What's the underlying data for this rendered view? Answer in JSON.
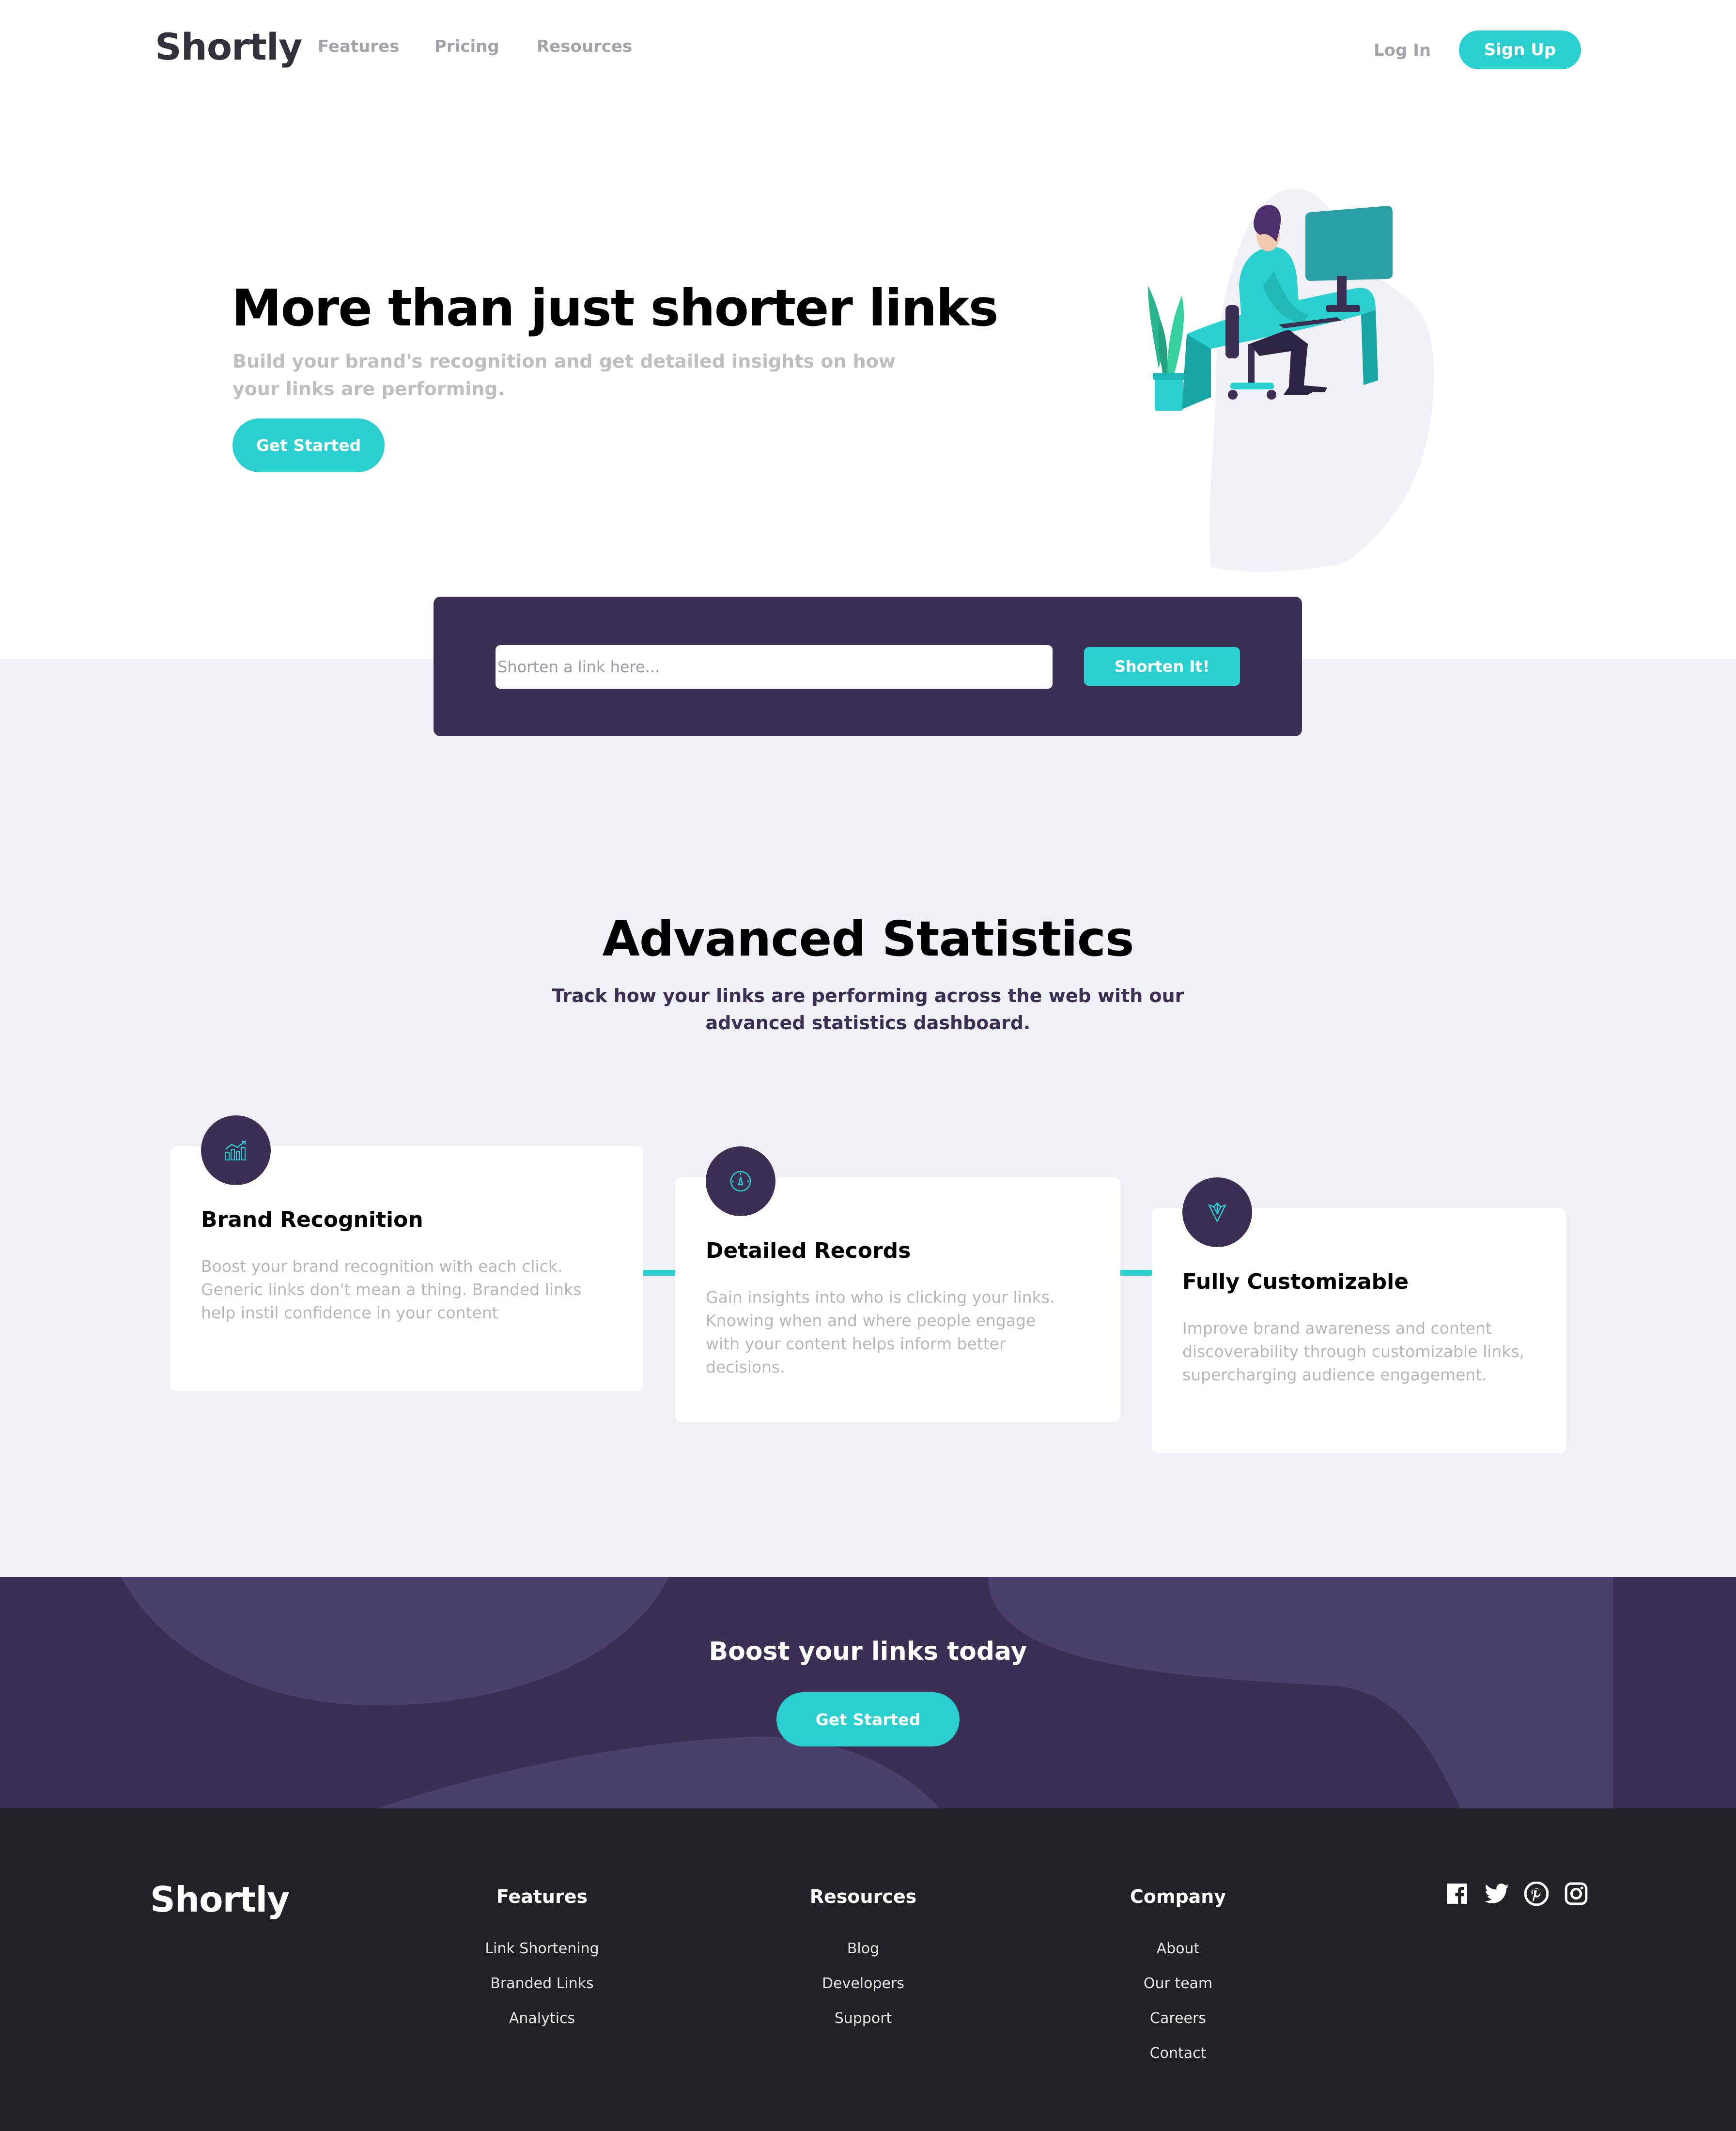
{
  "nav": {
    "logo": "Shortly",
    "links": [
      "Features",
      "Pricing",
      "Resources"
    ],
    "login": "Log In",
    "signup": "Sign Up"
  },
  "hero": {
    "title": "More than just shorter links",
    "subtitle": "Build your brand's recognition and get detailed insights on how your links are performing.",
    "cta": "Get Started"
  },
  "shorten": {
    "placeholder": "Shorten a link here...",
    "button": "Shorten It!"
  },
  "stats": {
    "title": "Advanced Statistics",
    "subtitle": "Track how your links are performing across the web with our advanced statistics dashboard.",
    "cards": [
      {
        "icon": "brand-recognition-icon",
        "title": "Brand Recognition",
        "text": "Boost your brand recognition with each click. Generic links don't mean a thing. Branded links help instil confidence in your content"
      },
      {
        "icon": "detailed-records-icon",
        "title": "Detailed Records",
        "text": "Gain insights into who is clicking your links. Knowing when and where people engage with your content helps inform better decisions."
      },
      {
        "icon": "fully-customizable-icon",
        "title": "Fully Customizable",
        "text": "Improve brand awareness and content discoverability through customizable links, supercharging audience engagement."
      }
    ]
  },
  "boost": {
    "title": "Boost your links today",
    "cta": "Get Started"
  },
  "footer": {
    "logo": "Shortly",
    "columns": [
      {
        "heading": "Features",
        "links": [
          "Link Shortening",
          "Branded Links",
          "Analytics"
        ]
      },
      {
        "heading": "Resources",
        "links": [
          "Blog",
          "Developers",
          "Support"
        ]
      },
      {
        "heading": "Company",
        "links": [
          "About",
          "Our team",
          "Careers",
          "Contact"
        ]
      }
    ],
    "socials": [
      "facebook-icon",
      "twitter-icon",
      "pinterest-icon",
      "instagram-icon"
    ]
  },
  "colors": {
    "cyan": "#2acfcf",
    "dark_violet": "#3b3054",
    "very_dark_violet": "#232127",
    "light_gray_bg": "#eff1f6",
    "gray_text": "#bfbfbf"
  }
}
